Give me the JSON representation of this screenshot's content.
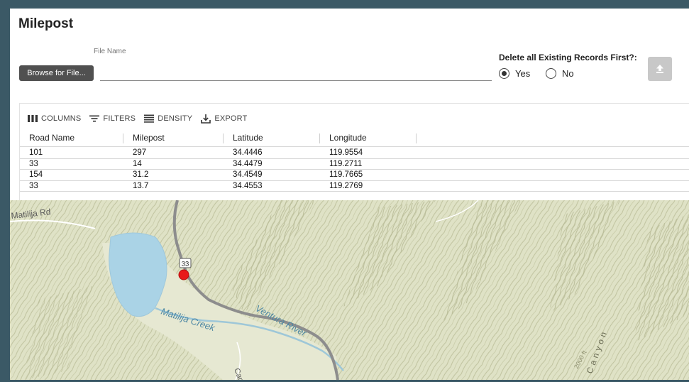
{
  "page_title": "Milepost",
  "file_field": {
    "label": "File Name",
    "value": "",
    "placeholder": "",
    "browse_label": "Browse for File..."
  },
  "delete_option": {
    "label": "Delete all Existing Records First?:",
    "options": [
      {
        "label": "Yes",
        "selected": true
      },
      {
        "label": "No",
        "selected": false
      }
    ],
    "upload_icon": "upload-icon"
  },
  "toolbar": {
    "columns_label": "COLUMNS",
    "filters_label": "FILTERS",
    "density_label": "DENSITY",
    "export_label": "EXPORT"
  },
  "table": {
    "headers": [
      "Road Name",
      "Milepost",
      "Latitude",
      "Longitude"
    ],
    "rows": [
      [
        "101",
        "297",
        "34.4446",
        "119.9554"
      ],
      [
        "33",
        "14",
        "34.4479",
        "119.2711"
      ],
      [
        "154",
        "31.2",
        "34.4549",
        "119.7665"
      ],
      [
        "33",
        "13.7",
        "34.4553",
        "119.2769"
      ]
    ]
  },
  "map": {
    "labels": {
      "road": "Matilija Rd",
      "creek": "Matilija Creek",
      "river": "Ventura River",
      "highway_shield": "33",
      "contour": "2000 ft",
      "canyon": "Canyon",
      "partial": "Cam"
    },
    "colors": {
      "marker": "#e8191a",
      "lake": "#aad3e6",
      "terrain": "#dfe2c6",
      "road": "#8d8d8d"
    }
  }
}
